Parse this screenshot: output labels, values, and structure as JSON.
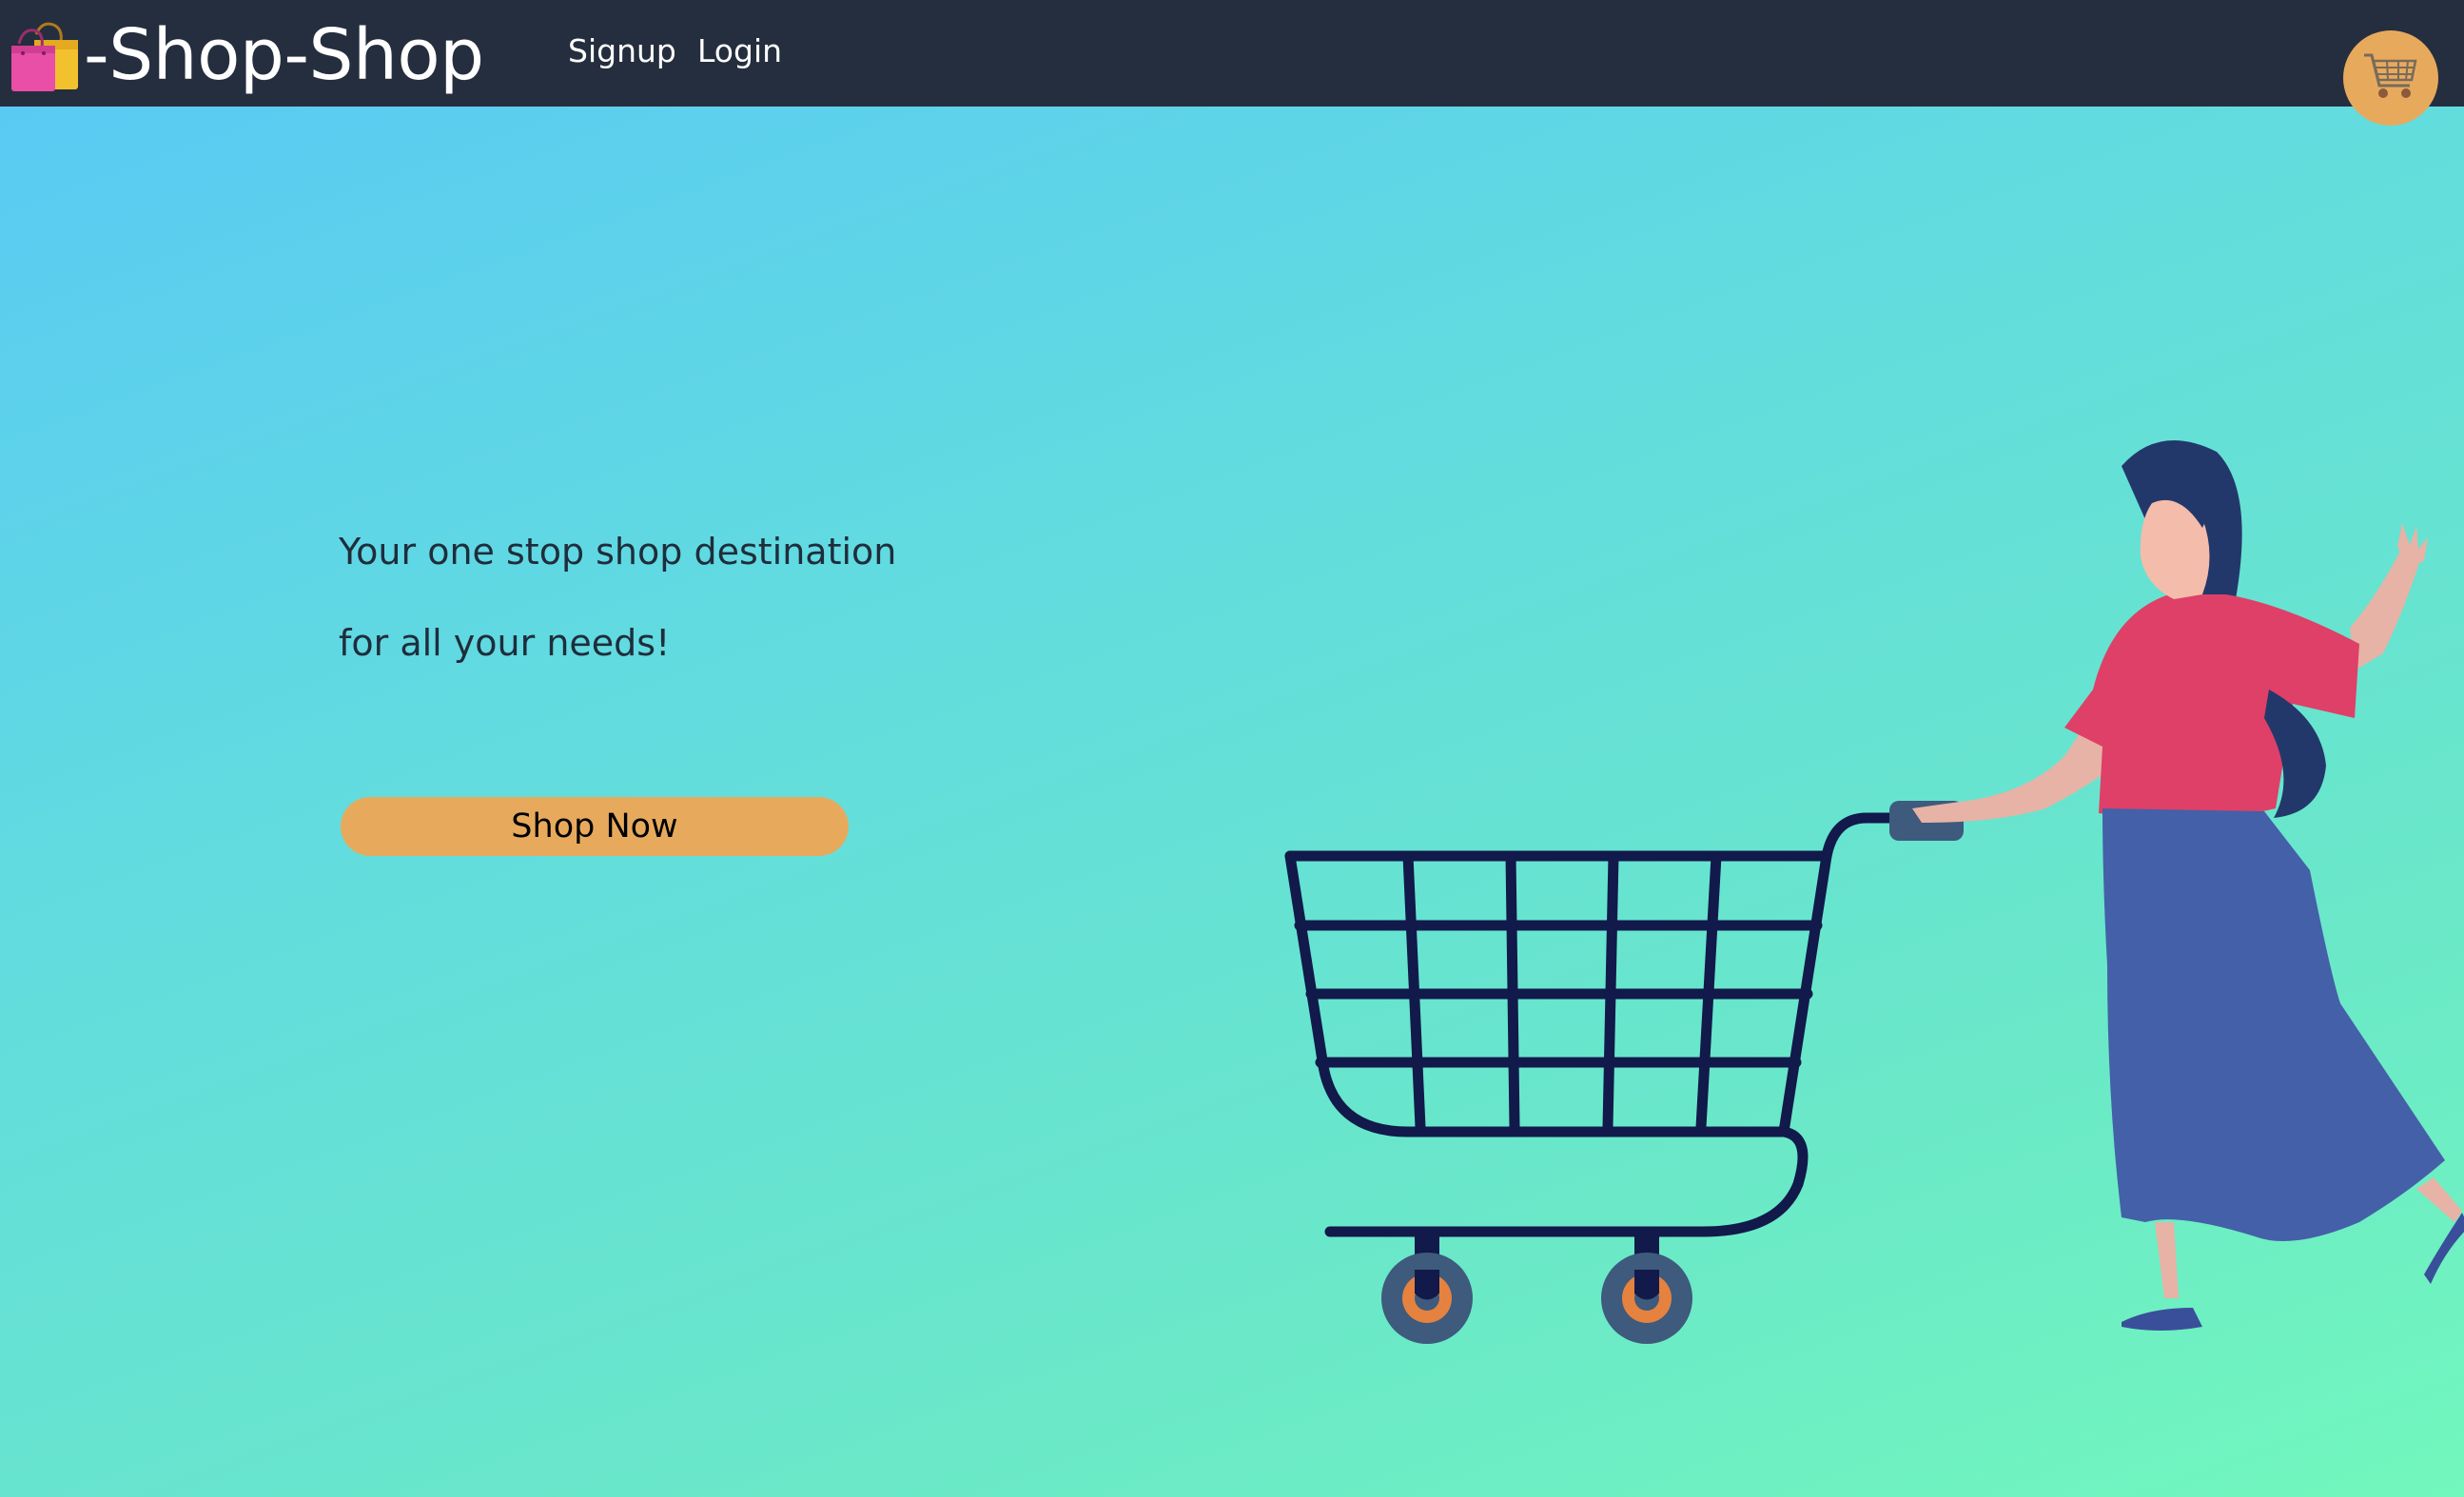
{
  "header": {
    "brand_title": "-Shop-Shop",
    "brand_icon": "shopping-bags-icon",
    "nav": [
      {
        "label": "Signup"
      },
      {
        "label": "Login"
      }
    ],
    "cart_icon": "shopping-cart-icon"
  },
  "hero": {
    "tagline_line1": "Your one stop shop destination",
    "tagline_line2": "for all your needs!",
    "cta_label": "Shop Now",
    "illustration": "woman-pushing-shopping-cart"
  },
  "colors": {
    "navbar": "#252e3e",
    "accent": "#e7aa5d",
    "gradient_start": "#58c8f6",
    "gradient_end": "#72f7bd",
    "text_dark": "#1f2d3b"
  }
}
